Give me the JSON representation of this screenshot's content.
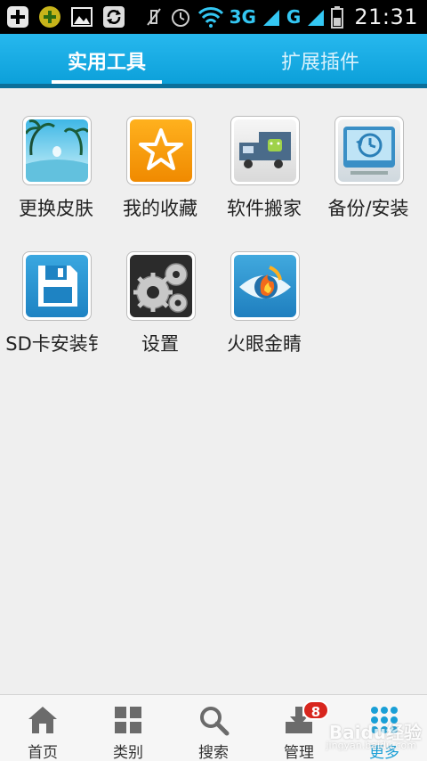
{
  "status_bar": {
    "network_1": "3G",
    "network_2": "G",
    "time": "21:31",
    "icons": [
      "add-icon",
      "game-icon",
      "gallery-icon",
      "sync-icon",
      "mute-icon",
      "alarm-icon",
      "wifi-icon",
      "signal-icon",
      "battery-icon"
    ]
  },
  "tabs": [
    {
      "label": "实用工具",
      "active": true
    },
    {
      "label": "扩展插件",
      "active": false
    }
  ],
  "apps": [
    {
      "label": "更换皮肤",
      "icon": "skin-icon"
    },
    {
      "label": "我的收藏",
      "icon": "star-icon"
    },
    {
      "label": "软件搬家",
      "icon": "truck-icon"
    },
    {
      "label": "备份/安装",
      "icon": "backup-icon"
    },
    {
      "label": "SD卡安装钅",
      "icon": "floppy-icon"
    },
    {
      "label": "设置",
      "icon": "gear-icon"
    },
    {
      "label": "火眼金睛",
      "icon": "eye-icon"
    }
  ],
  "bottom_nav": [
    {
      "label": "首页",
      "icon": "home-icon"
    },
    {
      "label": "类别",
      "icon": "category-icon"
    },
    {
      "label": "搜索",
      "icon": "search-icon"
    },
    {
      "label": "管理",
      "icon": "manage-icon",
      "badge": "8"
    },
    {
      "label": "更多",
      "icon": "more-icon",
      "active": true
    }
  ],
  "watermark": {
    "text": "Baidu经验",
    "sub": "jingyan.baidu.com"
  },
  "colors": {
    "accent": "#0a9ed8",
    "badge": "#d8261e"
  }
}
